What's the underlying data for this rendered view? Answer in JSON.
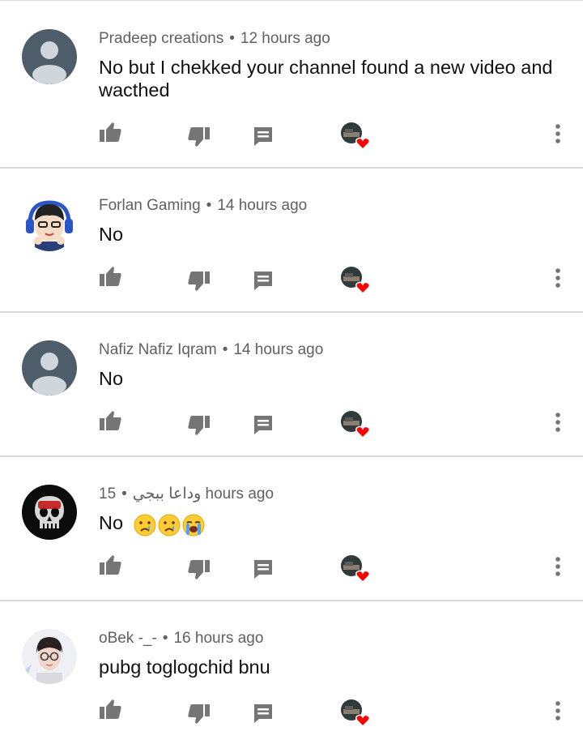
{
  "comments": [
    {
      "author": "Pradeep creations",
      "time": "12 hours ago",
      "text": "No but I chekked your channel found a new video and wacthed",
      "avatar": "default-avatar",
      "emojis": []
    },
    {
      "author": "Forlan Gaming",
      "time": "14 hours ago",
      "text": "No",
      "avatar": "cartoon-gamer-avatar",
      "emojis": []
    },
    {
      "author": "Nafiz Nafiz Iqram",
      "time": "14 hours ago",
      "text": "No",
      "avatar": "default-avatar",
      "emojis": []
    },
    {
      "author": "وداعا ببجي",
      "time": "15 hours ago",
      "text": "No",
      "avatar": "skull-avatar",
      "emojis": [
        "crying-face",
        "crying-face",
        "loudly-crying-face"
      ]
    },
    {
      "author": "oBek -_-",
      "time": "16 hours ago",
      "text": "pubg toglogchid bnu",
      "avatar": "photo-avatar",
      "emojis": []
    }
  ],
  "icons": {
    "like": "thumb-up-icon",
    "dislike": "thumb-down-icon",
    "reply": "reply-icon",
    "creator_heart": "creator-heart-icon",
    "more": "more-vert-icon"
  },
  "colors": {
    "meta_text": "#606060",
    "comment_text": "#111111",
    "icon": "#757575",
    "heart": "#ff0000",
    "divider": "#dadada"
  }
}
